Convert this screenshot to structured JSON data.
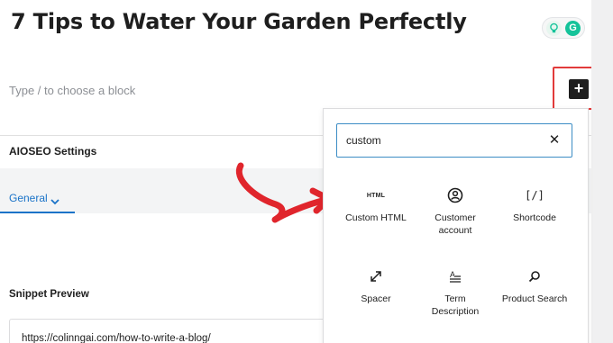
{
  "post": {
    "title": "7 Tips to Water Your Garden Perfectly",
    "block_placeholder": "Type / to choose a block",
    "inserter_label": "+"
  },
  "grammarly": {
    "logo_letter": "G",
    "icons": [
      "lightbulb-icon",
      "grammarly-icon"
    ]
  },
  "aioseo": {
    "title": "AIOSEO Settings",
    "tab_general": "General",
    "snippet_preview_label": "Snippet Preview",
    "snippet_url": "https://colinngai.com/how-to-write-a-blog/"
  },
  "inserter_popover": {
    "search_value": "custom",
    "clear_symbol": "✕",
    "blocks": [
      {
        "label": "Custom HTML",
        "icon": "html-icon",
        "icon_text": "HTML"
      },
      {
        "label": "Customer account",
        "icon": "account-icon"
      },
      {
        "label": "Shortcode",
        "icon": "shortcode-icon",
        "icon_text": "[/]"
      },
      {
        "label": "Spacer",
        "icon": "resize-arrow-icon"
      },
      {
        "label": "Term Description",
        "icon": "term-description-icon"
      },
      {
        "label": "Product Search",
        "icon": "search-icon"
      }
    ]
  },
  "colors": {
    "highlight_red": "#e23b3b",
    "arrow_red": "#e0252c",
    "accent_blue": "#1a73c8",
    "search_border": "#3c8dc5",
    "grammarly_green": "#15c39a"
  }
}
